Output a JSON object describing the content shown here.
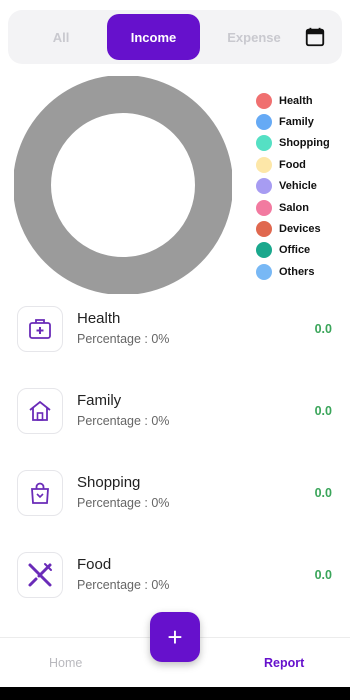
{
  "tabs": {
    "all": "All",
    "income": "Income",
    "expense": "Expense",
    "calendar_icon": "calendar-icon"
  },
  "chart_data": {
    "type": "pie",
    "categories": [
      "Health",
      "Family",
      "Shopping",
      "Food",
      "Vehicle",
      "Salon",
      "Devices",
      "Office",
      "Others"
    ],
    "values": [
      0,
      0,
      0,
      0,
      0,
      0,
      0,
      0,
      0
    ],
    "colors": [
      "#f07070",
      "#66aaf5",
      "#55e0c4",
      "#fde7a8",
      "#a79cf2",
      "#f27aa0",
      "#e0684f",
      "#1aa88d",
      "#78b8f5"
    ],
    "empty_ring_color": "#9b9b9b",
    "legend_position": "right"
  },
  "categories": [
    {
      "title": "Health",
      "subtitle": "Percentage : 0%",
      "value": "0.0",
      "icon": "first-aid-kit-icon"
    },
    {
      "title": "Family",
      "subtitle": "Percentage : 0%",
      "value": "0.0",
      "icon": "home-icon"
    },
    {
      "title": "Shopping",
      "subtitle": "Percentage : 0%",
      "value": "0.0",
      "icon": "shopping-bag-icon"
    },
    {
      "title": "Food",
      "subtitle": "Percentage : 0%",
      "value": "0.0",
      "icon": "fork-knife-icon"
    }
  ],
  "nav": {
    "home": "Home",
    "report": "Report",
    "fab": "+"
  },
  "colors": {
    "accent": "#6611cc",
    "value_green": "#3aa55a"
  }
}
